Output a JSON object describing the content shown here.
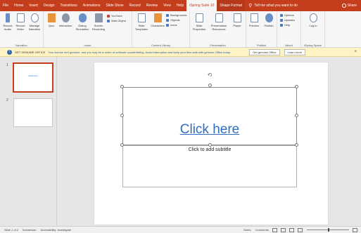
{
  "tabs": [
    "File",
    "Home",
    "Insert",
    "Design",
    "Transitions",
    "Animations",
    "Slide Show",
    "Record",
    "Review",
    "View",
    "Help",
    "iSpring Suite 10",
    "Shape Format"
  ],
  "tellme": "Tell me what you want to do",
  "user": "Share",
  "ribbon": {
    "record_audio": "Record Audio",
    "record_video": "Record Video",
    "manage_narration": "Manage Narration",
    "group_narration": "Narration",
    "quiz": "Quiz",
    "interaction": "Interaction",
    "dialog_simulation": "Dialog Simulation",
    "screen_recording": "Screen Recording",
    "youtube": "YouTube",
    "web_object": "Web Object",
    "group_insert": "Insert",
    "slide_templates": "Slide Templates",
    "characters": "Characters",
    "backgrounds": "Backgrounds",
    "objects": "Objects",
    "icons": "Icons",
    "group_content_library": "Content Library",
    "slide_properties": "Slide Properties",
    "presentation_resources": "Presentation Resources",
    "player": "Player",
    "group_presentation": "Presentation",
    "preview": "Preview",
    "publish": "Publish",
    "group_publish": "Publish",
    "options": "Options",
    "updates": "Updates",
    "help": "Help",
    "group_about": "About",
    "log_in": "Log In",
    "group_ispring_space": "iSpring Space"
  },
  "infobar": {
    "title": "GET GENUINE OFFICE",
    "message": "Your license isn't genuine, and you may be a victim of software counterfeiting. Avoid interruption and keep your files safe with genuine Office today.",
    "get_genuine": "Get genuine Office",
    "learn_more": "Learn more"
  },
  "slides": [
    {
      "number": "1",
      "thumb_text": "Click here"
    },
    {
      "number": "2",
      "thumb_text": ""
    }
  ],
  "slide": {
    "title": "Click here",
    "subtitle": "Click to add subtitle"
  },
  "status": {
    "slide_of": "Slide 1 of 2",
    "language": "Indonesian",
    "accessibility": "Accessibility: Investigate",
    "notes": "Notes",
    "comments": "Comments"
  },
  "colors": {
    "accent": "#c43e1c",
    "link": "#2f6fc0"
  }
}
